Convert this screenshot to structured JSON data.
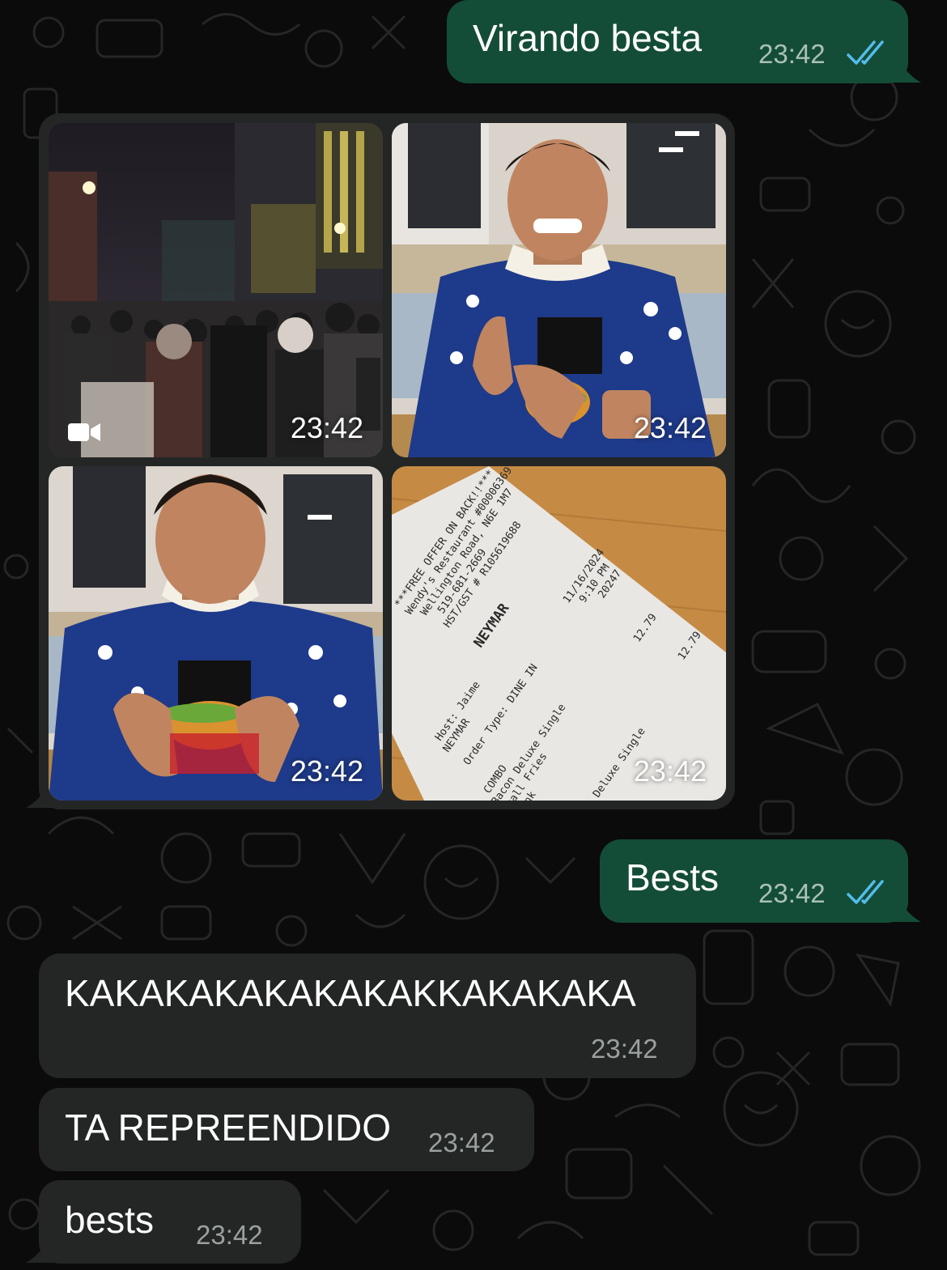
{
  "colors": {
    "background": "#0b0b0b",
    "outgoing_bubble": "#144d37",
    "incoming_bubble": "#242626",
    "read_ticks": "#53bdeb"
  },
  "messages": [
    {
      "direction": "outgoing",
      "text": "Virando besta",
      "time": "23:42",
      "status_icon": "double-check-read-icon"
    },
    {
      "direction": "incoming",
      "type": "album",
      "items": [
        {
          "kind": "video",
          "time": "23:42",
          "icon": "video-camera-icon"
        },
        {
          "kind": "photo",
          "time": "23:42"
        },
        {
          "kind": "photo",
          "time": "23:42"
        },
        {
          "kind": "photo",
          "time": "23:42"
        }
      ]
    },
    {
      "direction": "outgoing",
      "text": "Bests",
      "time": "23:42",
      "status_icon": "double-check-read-icon"
    },
    {
      "direction": "incoming",
      "text": "KAKAKAKAKAKAKAKKAKAKAKA",
      "time": "23:42"
    },
    {
      "direction": "incoming",
      "text": "TA REPREENDIDO",
      "time": "23:42"
    },
    {
      "direction": "incoming",
      "text": "bests",
      "time": "23:42"
    }
  ],
  "receipt": {
    "line1": "***FREE OFFER ON BACK!!***",
    "line2": "Wendy's Restaurant #00006369",
    "line3": "Wellington Road, N6E 1M7",
    "line4": "519-681-2669",
    "line5": "HST/GST # R105619688",
    "date": "11/16/2024",
    "clock": "9:10 PM",
    "order_no": "20247",
    "name": "NEYMAR",
    "host": "Host: Jaime",
    "host_name": "NEYMAR",
    "order_type": "Order Type: DINE IN",
    "combo": "COMBO",
    "item1": "Bacon Deluxe Single",
    "item2": "Small Fries",
    "item3": "Drink",
    "item4": "Deluxe Single",
    "price1": "12.79",
    "price2": "12.79"
  }
}
